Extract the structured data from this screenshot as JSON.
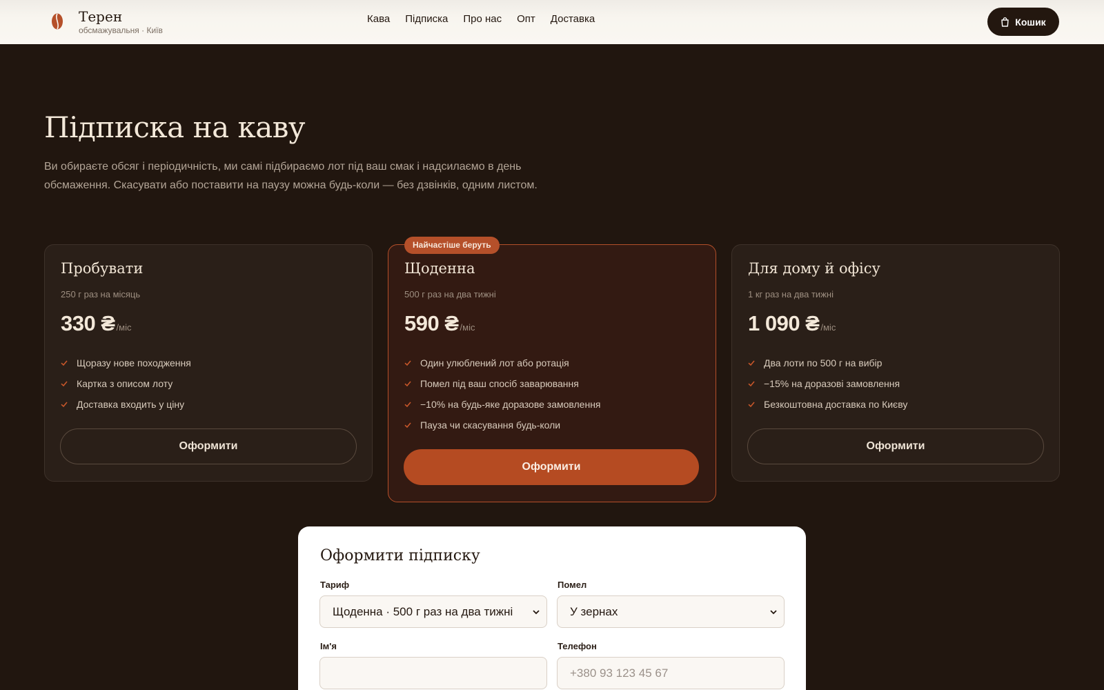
{
  "header": {
    "brand_name": "Терен",
    "brand_sub": "обсмажувальня · Київ",
    "nav": [
      "Кава",
      "Підписка",
      "Про нас",
      "Опт",
      "Доставка"
    ],
    "cart_label": "Кошик"
  },
  "hero": {
    "title": "Підписка на каву",
    "text": "Ви обираєте обсяг і періодичність, ми самі підбираємо лот під ваш смак і надсилаємо в день обсмаження. Скасувати або поставити на паузу можна будь-коли — без дзвінків, одним листом."
  },
  "plans": [
    {
      "name": "Пробувати",
      "desc": "250 г раз на місяць",
      "price": "330 ₴",
      "unit": "/міс",
      "features": [
        "Щоразу нове походження",
        "Картка з описом лоту",
        "Доставка входить у ціну"
      ],
      "button": "Оформити"
    },
    {
      "badge": "Найчастіше беруть",
      "name": "Щоденна",
      "desc": "500 г раз на два тижні",
      "price": "590 ₴",
      "unit": "/міс",
      "features": [
        "Один улюблений лот або ротація",
        "Помел під ваш спосіб заварювання",
        "−10% на будь-яке доразове замовлення",
        "Пауза чи скасування будь-коли"
      ],
      "button": "Оформити"
    },
    {
      "name": "Для дому й офісу",
      "desc": "1 кг раз на два тижні",
      "price": "1 090 ₴",
      "unit": "/міс",
      "features": [
        "Два лоти по 500 г на вибір",
        "−15% на доразові замовлення",
        "Безкоштовна доставка по Києву"
      ],
      "button": "Оформити"
    }
  ],
  "form": {
    "title": "Оформити підписку",
    "tariff_label": "Тариф",
    "tariff_value": "Щоденна · 500 г раз на два тижні",
    "grind_label": "Помел",
    "grind_value": "У зернах",
    "name_label": "Ім'я",
    "name_value": "",
    "phone_label": "Телефон",
    "phone_placeholder": "+380 93 123 45 67"
  },
  "colors": {
    "background": "#21160f",
    "accent": "#b5502a",
    "header": "#faf7f2"
  }
}
